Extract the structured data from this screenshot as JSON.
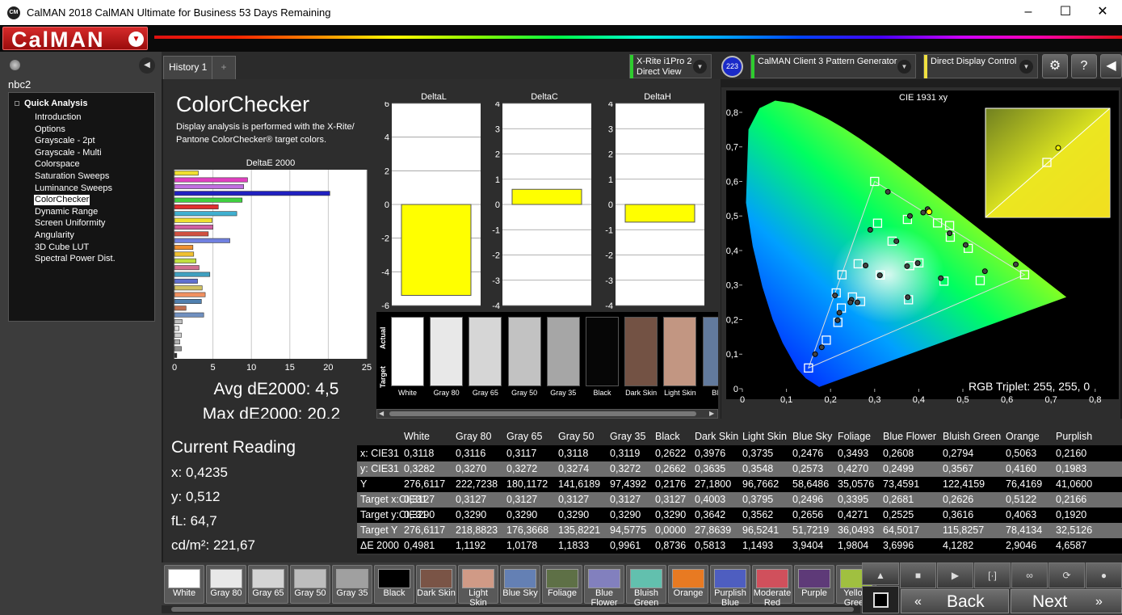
{
  "window": {
    "title": "CalMAN 2018 CalMAN Ultimate for Business 53 Days Remaining",
    "logo": "CM",
    "minimize": "–",
    "maximize": "☐",
    "close": "✕"
  },
  "brand": {
    "name": "CalMAN"
  },
  "sidebar": {
    "workspace": "nbc2",
    "tree_root": "Quick Analysis",
    "items": [
      "Introduction",
      "Options",
      "Grayscale - 2pt",
      "Grayscale - Multi",
      "Colorspace",
      "Saturation Sweeps",
      "Luminance Sweeps",
      "ColorChecker",
      "Dynamic Range",
      "Screen Uniformity",
      "Angularity",
      "3D Cube LUT",
      "Spectral Power Dist."
    ],
    "selected": "ColorChecker"
  },
  "tabs": {
    "history": "History 1",
    "add": "+"
  },
  "devices": {
    "meter_line1": "X-Rite i1Pro 2",
    "meter_line2": "Direct View",
    "meter_badge": "223",
    "pattern": "CalMAN Client 3 Pattern Generator",
    "display": "Direct Display Control"
  },
  "colorchecker": {
    "title": "ColorChecker",
    "desc": "Display analysis is performed with the X-Rite/ Pantone ColorChecker® target colors.",
    "deltae_title": "DeltaE 2000",
    "avg": "Avg dE2000: 4,5",
    "max": "Max dE2000: 20,2"
  },
  "chart_data": [
    {
      "type": "bar",
      "title": "DeltaE 2000",
      "orientation": "horizontal",
      "xlim": [
        0,
        25
      ],
      "xticks": [
        "0",
        "5",
        "10",
        "15",
        "20",
        "25"
      ],
      "values": [
        3.1,
        9.5,
        9.0,
        20.2,
        8.8,
        5.7,
        8.1,
        4.9,
        5.0,
        4.4,
        7.2,
        2.4,
        2.5,
        2.8,
        3.2,
        4.6,
        3.0,
        3.6,
        4.0,
        3.5,
        1.5,
        3.8,
        1.0,
        0.6,
        0.9,
        0.7,
        0.9,
        0.3
      ],
      "colors": [
        "#f0e030",
        "#e040c0",
        "#c070e0",
        "#2020c0",
        "#40d040",
        "#e03030",
        "#40b0d0",
        "#f0e030",
        "#d060a0",
        "#d05040",
        "#7080e0",
        "#f09030",
        "#f0c030",
        "#c0e040",
        "#d07090",
        "#40a0c0",
        "#6070d0",
        "#d0c060",
        "#f09060",
        "#5080b0",
        "#c07050",
        "#7090c0",
        "#c0c0c0",
        "#e0e0e0",
        "#d0d0d0",
        "#b0b0b0",
        "#909090",
        "#303030"
      ]
    },
    {
      "type": "bar",
      "title": "DeltaL",
      "ylim": [
        -6,
        6
      ],
      "yticks": [
        "6",
        "4",
        "2",
        "0",
        "-2",
        "-4",
        "-6"
      ],
      "values": [
        -5.4
      ],
      "color": "#ffff00"
    },
    {
      "type": "bar",
      "title": "DeltaC",
      "ylim": [
        -4,
        4
      ],
      "yticks": [
        "4",
        "3",
        "2",
        "1",
        "0",
        "-1",
        "-2",
        "-3",
        "-4"
      ],
      "values": [
        0.6
      ],
      "color": "#ffff00"
    },
    {
      "type": "bar",
      "title": "DeltaH",
      "ylim": [
        -4,
        4
      ],
      "yticks": [
        "4",
        "3",
        "2",
        "1",
        "0",
        "-1",
        "-2",
        "-3",
        "-4"
      ],
      "values": [
        -0.7
      ],
      "color": "#ffff00"
    },
    {
      "type": "scatter",
      "title": "CIE 1931 xy",
      "xlim": [
        0,
        0.8
      ],
      "ylim": [
        0,
        0.8
      ],
      "xticks": [
        "0",
        "0,1",
        "0,2",
        "0,3",
        "0,4",
        "0,5",
        "0,6",
        "0,7",
        "0,8"
      ],
      "yticks": [
        "0,8",
        "0,7",
        "0,6",
        "0,5",
        "0,4",
        "0,3",
        "0,2",
        "0,1",
        "0"
      ],
      "gamut": [
        [
          0.64,
          0.33
        ],
        [
          0.3,
          0.6
        ],
        [
          0.15,
          0.06
        ]
      ],
      "targets": [
        [
          0.3127,
          0.329
        ],
        [
          0.4003,
          0.3642
        ],
        [
          0.3795,
          0.3562
        ],
        [
          0.2496,
          0.2656
        ],
        [
          0.3395,
          0.4271
        ],
        [
          0.2681,
          0.2525
        ],
        [
          0.2626,
          0.3616
        ],
        [
          0.5122,
          0.4063
        ],
        [
          0.2166,
          0.192
        ],
        [
          0.4571,
          0.3113
        ],
        [
          0.3743,
          0.49
        ],
        [
          0.4715,
          0.4386
        ],
        [
          0.1904,
          0.1406
        ],
        [
          0.3066,
          0.4791
        ],
        [
          0.5393,
          0.3131
        ],
        [
          0.4699,
          0.4723
        ],
        [
          0.3767,
          0.2575
        ],
        [
          0.2128,
          0.2773
        ],
        [
          0.3127,
          0.329
        ],
        [
          0.226,
          0.3298
        ],
        [
          0.3,
          0.6
        ],
        [
          0.64,
          0.33
        ],
        [
          0.15,
          0.06
        ],
        [
          0.2246,
          0.2336
        ],
        [
          0.4425,
          0.4798
        ]
      ],
      "actual": [
        [
          0.3118,
          0.3282
        ],
        [
          0.3976,
          0.3635
        ],
        [
          0.3735,
          0.3548
        ],
        [
          0.2476,
          0.2573
        ],
        [
          0.3493,
          0.427
        ],
        [
          0.2608,
          0.2499
        ],
        [
          0.2794,
          0.3567
        ],
        [
          0.5063,
          0.416
        ],
        [
          0.216,
          0.1983
        ],
        [
          0.45,
          0.32
        ],
        [
          0.38,
          0.5
        ],
        [
          0.47,
          0.45
        ],
        [
          0.18,
          0.12
        ],
        [
          0.29,
          0.46
        ],
        [
          0.55,
          0.34
        ],
        [
          0.41,
          0.51
        ],
        [
          0.375,
          0.265
        ],
        [
          0.21,
          0.27
        ],
        [
          0.3118,
          0.3282
        ],
        [
          0.245,
          0.25
        ],
        [
          0.33,
          0.57
        ],
        [
          0.62,
          0.36
        ],
        [
          0.165,
          0.1
        ],
        [
          0.22,
          0.22
        ],
        [
          0.42,
          0.52
        ]
      ],
      "current": [
        0.4235,
        0.512
      ],
      "rgb_triplet": "RGB Triplet: 255, 255, 0"
    }
  ],
  "swatch_strip": [
    {
      "label": "White",
      "color": "#ffffff"
    },
    {
      "label": "Gray 80",
      "color": "#e8e8e8"
    },
    {
      "label": "Gray 65",
      "color": "#d6d6d6"
    },
    {
      "label": "Gray 50",
      "color": "#c2c2c2"
    },
    {
      "label": "Gray 35",
      "color": "#a6a6a6"
    },
    {
      "label": "Black",
      "color": "#060606"
    },
    {
      "label": "Dark Skin",
      "color": "#735244"
    },
    {
      "label": "Light Skin",
      "color": "#c29682"
    },
    {
      "label": "Blue",
      "color": "#627a9d"
    }
  ],
  "strip_labels": {
    "actual": "Actual",
    "target": "Target"
  },
  "current_reading": {
    "title": "Current Reading",
    "x": "x: 0,4235",
    "y": "y: 0,512",
    "fl": "fL: 64,7",
    "cdm2": "cd/m²: 221,67"
  },
  "table": {
    "columns": [
      "",
      "White",
      "Gray 80",
      "Gray 65",
      "Gray 50",
      "Gray 35",
      "Black",
      "Dark Skin",
      "Light Skin",
      "Blue Sky",
      "Foliage",
      "Blue Flower",
      "Bluish Green",
      "Orange",
      "Purplish"
    ],
    "rows": [
      [
        "x: CIE31",
        "0,3118",
        "0,3116",
        "0,3117",
        "0,3118",
        "0,3119",
        "0,2622",
        "0,3976",
        "0,3735",
        "0,2476",
        "0,3493",
        "0,2608",
        "0,2794",
        "0,5063",
        "0,2160"
      ],
      [
        "y: CIE31",
        "0,3282",
        "0,3270",
        "0,3272",
        "0,3274",
        "0,3272",
        "0,2662",
        "0,3635",
        "0,3548",
        "0,2573",
        "0,4270",
        "0,2499",
        "0,3567",
        "0,4160",
        "0,1983"
      ],
      [
        "Y",
        "276,6117",
        "222,7238",
        "180,1172",
        "141,6189",
        "97,4392",
        "0,2176",
        "27,1800",
        "96,7662",
        "58,6486",
        "35,0576",
        "73,4591",
        "122,4159",
        "76,4169",
        "41,0600"
      ],
      [
        "Target x:CIE31",
        "0,3127",
        "0,3127",
        "0,3127",
        "0,3127",
        "0,3127",
        "0,3127",
        "0,4003",
        "0,3795",
        "0,2496",
        "0,3395",
        "0,2681",
        "0,2626",
        "0,5122",
        "0,2166"
      ],
      [
        "Target y:CIE31",
        "0,3290",
        "0,3290",
        "0,3290",
        "0,3290",
        "0,3290",
        "0,3290",
        "0,3642",
        "0,3562",
        "0,2656",
        "0,4271",
        "0,2525",
        "0,3616",
        "0,4063",
        "0,1920"
      ],
      [
        "Target Y",
        "276,6117",
        "218,8823",
        "176,3668",
        "135,8221",
        "94,5775",
        "0,0000",
        "27,8639",
        "96,5241",
        "51,7219",
        "36,0493",
        "64,5017",
        "115,8257",
        "78,4134",
        "32,5126"
      ],
      [
        "ΔE 2000",
        "0,4981",
        "1,1192",
        "1,0178",
        "1,1833",
        "0,9961",
        "0,8736",
        "0,5813",
        "1,1493",
        "3,9404",
        "1,9804",
        "3,6996",
        "4,1282",
        "2,9046",
        "4,6587"
      ]
    ]
  },
  "bottom_tiles": [
    {
      "label": "White",
      "color": "#ffffff"
    },
    {
      "label": "Gray 80",
      "color": "#e8e8e8"
    },
    {
      "label": "Gray 65",
      "color": "#d4d4d4"
    },
    {
      "label": "Gray 50",
      "color": "#bdbdbd"
    },
    {
      "label": "Gray 35",
      "color": "#a0a0a0"
    },
    {
      "label": "Black",
      "color": "#000000"
    },
    {
      "label": "Dark Skin",
      "color": "#7a5446"
    },
    {
      "label": "Light Skin",
      "color": "#d09a86"
    },
    {
      "label": "Blue Sky",
      "color": "#6480b4"
    },
    {
      "label": "Foliage",
      "color": "#5e7046"
    },
    {
      "label": "Blue Flower",
      "color": "#8280be"
    },
    {
      "label": "Bluish Green",
      "color": "#62c0ae"
    },
    {
      "label": "Orange",
      "color": "#e87a22"
    },
    {
      "label": "Purplish Blue",
      "color": "#4e5ec0"
    },
    {
      "label": "Moderate Red",
      "color": "#d0505c"
    },
    {
      "label": "Purple",
      "color": "#5e3a78"
    },
    {
      "label": "Yellow Green",
      "color": "#a0c040"
    }
  ],
  "nav": {
    "back": "Back",
    "next": "Next"
  }
}
